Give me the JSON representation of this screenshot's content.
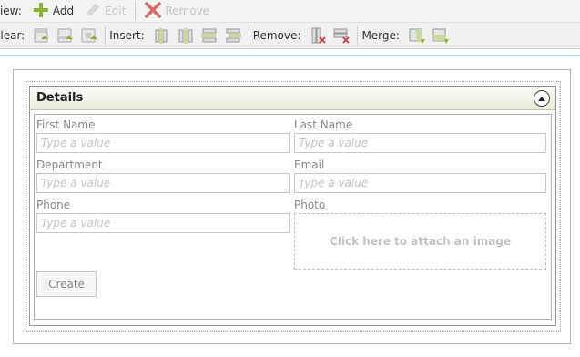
{
  "toolbar_view": {
    "label": "View:",
    "add_label": "Add",
    "edit_label": "Edit",
    "remove_label": "Remove"
  },
  "toolbar_layout": {
    "clear_label": "Clear:",
    "insert_label": "Insert:",
    "remove_label": "Remove:",
    "merge_label": "Merge:"
  },
  "panel": {
    "title": "Details"
  },
  "form": {
    "first_name": {
      "label": "First Name",
      "placeholder": "Type a value"
    },
    "last_name": {
      "label": "Last Name",
      "placeholder": "Type a value"
    },
    "department": {
      "label": "Department",
      "placeholder": "Type a value"
    },
    "email": {
      "label": "Email",
      "placeholder": "Type a value"
    },
    "phone": {
      "label": "Phone",
      "placeholder": "Type a value"
    },
    "photo": {
      "label": "Photo",
      "hint": "Click here to attach an image"
    },
    "create_label": "Create"
  },
  "colors": {
    "add_icon": "#8db42e",
    "remove_icon": "#d04848",
    "accent_line": "#2a78c8"
  }
}
